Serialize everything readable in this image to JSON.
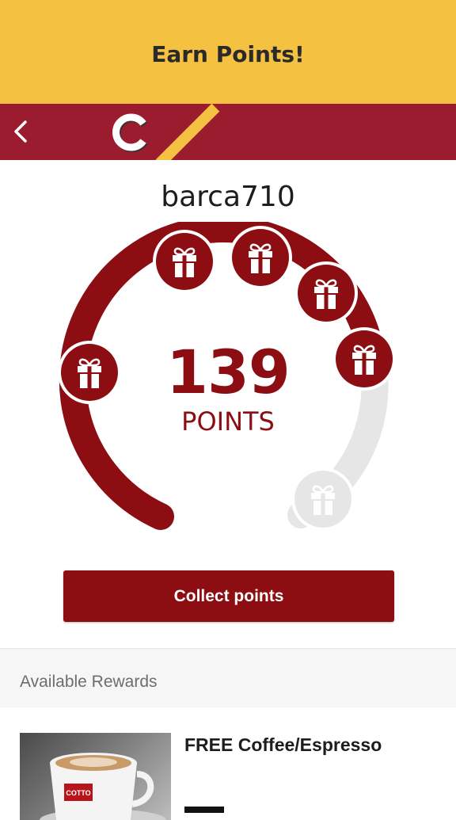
{
  "header": {
    "title": "Earn Points!"
  },
  "nav": {
    "back_icon": "chevron-left-icon",
    "logo_letter": "C"
  },
  "profile": {
    "username": "barca710"
  },
  "points": {
    "value": "139",
    "label": "POINTS",
    "gift_icon": "gift-icon",
    "gifts_total": 6,
    "gifts_unlocked": 5
  },
  "actions": {
    "collect_label": "Collect points"
  },
  "rewards": {
    "section_title": "Available Rewards",
    "items": [
      {
        "name": "FREE Coffee/Espresso",
        "cup_brand": "COTTO"
      }
    ]
  },
  "colors": {
    "accent_yellow": "#f5c140",
    "brand_red": "#9b1c2e",
    "points_red": "#8c0d12",
    "inactive_gray": "#e6e6e6"
  }
}
